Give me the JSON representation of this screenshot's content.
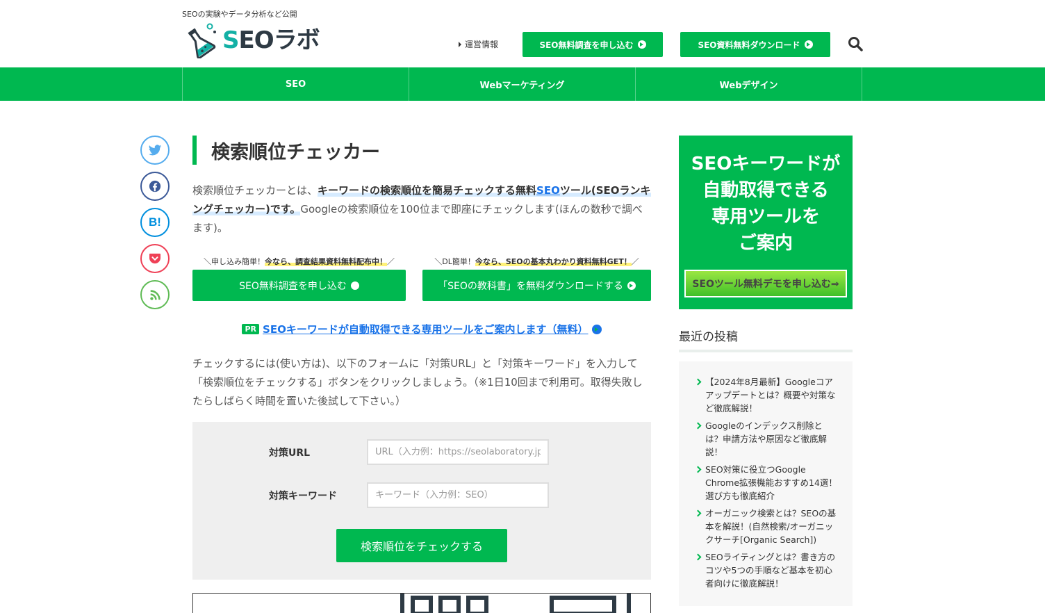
{
  "header": {
    "tagline": "SEOの実験やデータ分析など公開",
    "logo_s": "S",
    "logo_rest": "EOラボ",
    "info_link": "運営情報",
    "btn_survey": "SEO無料調査を申し込む",
    "btn_download": "SEO資料無料ダウンロード"
  },
  "gnav": [
    "SEO",
    "Webマーケティング",
    "Webデザイン"
  ],
  "share": {
    "hatena": "B!"
  },
  "main": {
    "title": "検索順位チェッカー",
    "intro_pre": "検索順位チェッカーとは、",
    "intro_hl1": "キーワードの検索順位を簡易チェックする無料",
    "intro_link": "SEO",
    "intro_hl2": "ツール(SEOランキングチェッカー)です。",
    "intro_post": "Googleの検索順位を100位まで即座にチェックします(ほんの数秒で調べます)。",
    "cta1_cap_pre": "＼申し込み簡単！",
    "cta1_cap_hl": "今なら、調査結果資料無料配布中！",
    "cta1_cap_post": "／",
    "cta1_label": "SEO無料調査を申し込む",
    "cta2_cap_pre": "＼DL簡単！",
    "cta2_cap_hl": "今なら、SEOの基本丸わかり資料無料GET！",
    "cta2_cap_post": "／",
    "cta2_label": "「SEOの教科書」を無料ダウンロードする",
    "pr_badge": "PR",
    "pr_link": "SEOキーワードが自動取得できる専用ツールをご案内します（無料）",
    "howto": "チェックするには(使い方は)、以下のフォームに「対策URL」と「対策キーワード」を入力して「検索順位をチェックする」ボタンをクリックしましょう。（※1日10回まで利用可。取得失敗したらしばらく時間を置いた後試して下さい。）"
  },
  "form": {
    "url_label": "対策URL",
    "url_placeholder": "URL（入力例：https://seolaboratory.jp）",
    "kw_label": "対策キーワード",
    "kw_placeholder": "キーワード（入力例：SEO）",
    "submit": "検索順位をチェックする"
  },
  "sidebar": {
    "ad_line1": "SEOキーワードが",
    "ad_line2": "自動取得できる",
    "ad_line3": "専用ツールを",
    "ad_line4": "ご案内",
    "ad_button": "SEOツール無料デモを申し込む⇒",
    "recent_title": "最近の投稿",
    "recent": [
      "【2024年8月最新】Googleコアアップデートとは？概要や対策など徹底解説！",
      "Googleのインデックス削除とは？申請方法や原因など徹底解説！",
      "SEO対策に役立つGoogle Chrome拡張機能おすすめ14選！選び方も徹底紹介",
      "オーガニック検索とは？SEOの基本を解説！(自然検索/オーガニックサーチ[Organic Search])",
      "SEOライティングとは？書き方のコツや5つの手順など基本を初心者向けに徹底解説！"
    ]
  },
  "colors": {
    "brand_green": "#00b850",
    "link_blue": "#1a73e8",
    "logo_teal": "#13b0a5"
  }
}
